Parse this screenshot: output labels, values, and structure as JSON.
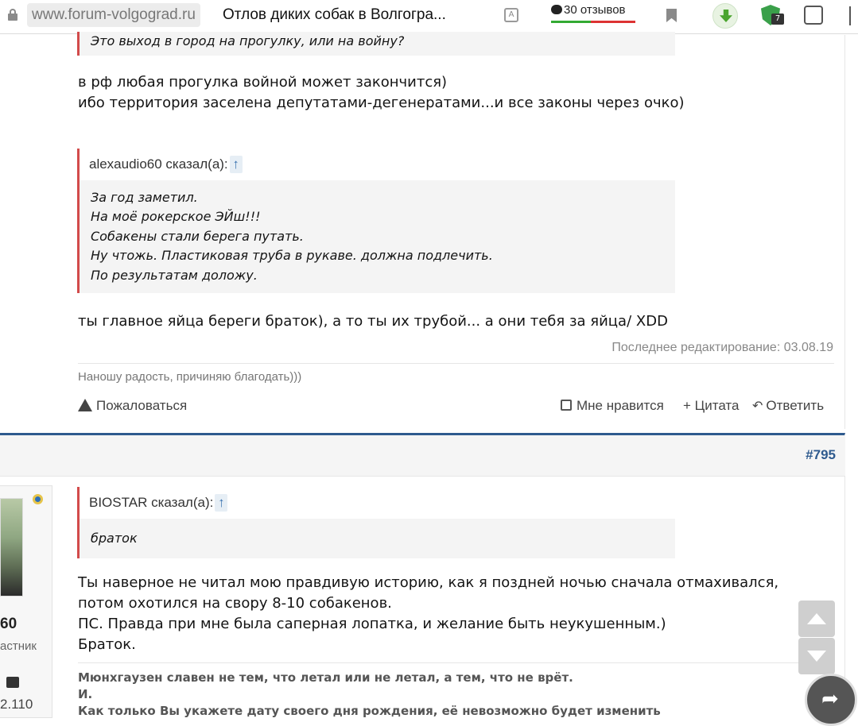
{
  "browser": {
    "domain": "www.forum-volgograd.ru",
    "tab_title": "Отлов диких собак в Волгогра...",
    "reviews_label": "30 отзывов",
    "shield_badge": "7"
  },
  "post1": {
    "quote_top_text": "Это выход в город на прогулку, или на войну?",
    "reply_lines": [
      "в рф любая прогулка войной может закончится)",
      "ибо территория заселена депутатами-дегенератами...и все законы через очко)"
    ],
    "quote2": {
      "attribution": "alexaudio60 сказал(а):",
      "arrow": "↑",
      "lines": [
        "За год заметил.",
        "На моё рокерское ЭЙш!!!",
        "Собакены стали берега путать.",
        "Ну чтожь. Пластиковая труба в рукаве. должна подлечить.",
        "По результатам доложу."
      ]
    },
    "reply2": "ты главное яйца береги браток), а то ты их трубой... а они тебя за яйца/ XDD",
    "edited": "Последнее редактирование: 03.08.19",
    "signature": "Наношу радость, причиняю благодать)))",
    "actions": {
      "report": "Пожаловаться",
      "like": "Мне нравится",
      "quote": "+ Цитата",
      "reply": "Ответить"
    }
  },
  "post2": {
    "number": "#795",
    "user": {
      "name": "60",
      "title": "астник",
      "score": "2.110"
    },
    "quote": {
      "attribution": "BIOSTAR сказал(а):",
      "arrow": "↑",
      "text": "браток"
    },
    "body_lines": [
      "Ты наверное не читал мою правдивую историю, как я поздней ночью сначала отмахивался,",
      "потом охотился на свору 8-10 собакенов.",
      "ПС. Правда при мне была саперная лопатка, и желание быть неукушенным.)",
      "Браток."
    ],
    "signature_lines": [
      "Мюнхгаузен славен не тем, что летал или не летал, а тем, что не врёт.",
      "И.",
      "Как только Вы укажете дату своего дня рождения, её невозможно будет изменить"
    ]
  },
  "colors": {
    "quote_border": "#d24b4b",
    "post_accent": "#2e5a8e",
    "review_bar": "#d33"
  },
  "icons": [
    "lock-icon",
    "translate-icon",
    "comment-icon",
    "bookmark-icon",
    "download-icon",
    "shield-icon",
    "extension-icon",
    "warning-icon",
    "thumbs-up-icon",
    "reply-icon",
    "share-icon"
  ]
}
